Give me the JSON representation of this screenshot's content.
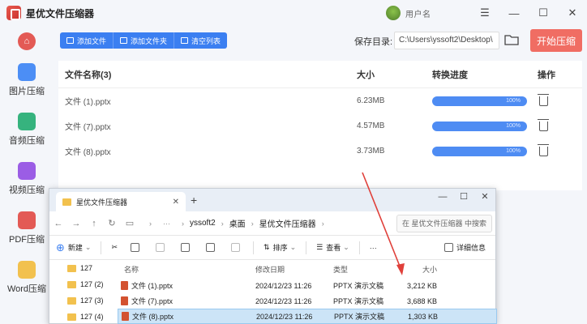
{
  "app": {
    "title": "星优文件压缩器",
    "user_name": "用户名"
  },
  "window_controls": {
    "menu": "☰",
    "minimize": "—",
    "maximize": "☐",
    "close": "✕"
  },
  "sidebar": {
    "items": [
      {
        "label": "图片压缩",
        "icon": "image-compress-icon",
        "color": "#4c8ef5"
      },
      {
        "label": "音频压缩",
        "icon": "audio-compress-icon",
        "color": "#36b37e"
      },
      {
        "label": "视频压缩",
        "icon": "video-compress-icon",
        "color": "#9b5de5"
      },
      {
        "label": "PDF压缩",
        "icon": "pdf-compress-icon",
        "color": "#e35a55"
      },
      {
        "label": "Word压缩",
        "icon": "word-compress-icon",
        "color": "#3b7ff1"
      }
    ]
  },
  "toolbar": {
    "add_file": "添加文件",
    "add_folder": "添加文件夹",
    "clear_list": "清空列表"
  },
  "save": {
    "label": "保存目录:",
    "path": "C:\\Users\\yssoft2\\Desktop\\"
  },
  "start_button": "开始压缩",
  "table": {
    "headers": {
      "name": "文件名称(3)",
      "size": "大小",
      "progress": "转换进度",
      "action": "操作"
    },
    "rows": [
      {
        "name": "文件 (1).pptx",
        "size": "6.23MB",
        "progress": "100%"
      },
      {
        "name": "文件 (7).pptx",
        "size": "4.57MB",
        "progress": "100%"
      },
      {
        "name": "文件 (8).pptx",
        "size": "3.73MB",
        "progress": "100%"
      }
    ]
  },
  "explorer": {
    "tab_title": "星优文件压缩器",
    "breadcrumb": [
      "yssoft2",
      "桌面",
      "星优文件压缩器"
    ],
    "search_placeholder": "在 星优文件压缩器 中搜索",
    "commands": {
      "new": "新建",
      "sort": "排序",
      "view": "查看",
      "more": "···",
      "details": "详细信息"
    },
    "tree": [
      "127",
      "127 (2)",
      "127 (3)",
      "127 (4)"
    ],
    "list_headers": {
      "name": "名称",
      "date": "修改日期",
      "type": "类型",
      "size": "大小"
    },
    "files": [
      {
        "name": "文件 (1).pptx",
        "date": "2024/12/23 11:26",
        "type": "PPTX 演示文稿",
        "size": "3,212 KB"
      },
      {
        "name": "文件 (7).pptx",
        "date": "2024/12/23 11:26",
        "type": "PPTX 演示文稿",
        "size": "3,688 KB"
      },
      {
        "name": "文件 (8).pptx",
        "date": "2024/12/23 11:26",
        "type": "PPTX 演示文稿",
        "size": "1,303 KB"
      }
    ]
  },
  "colors": {
    "accent": "#3b7ff1",
    "start": "#f06d63",
    "progress": "#4e8cf3"
  }
}
